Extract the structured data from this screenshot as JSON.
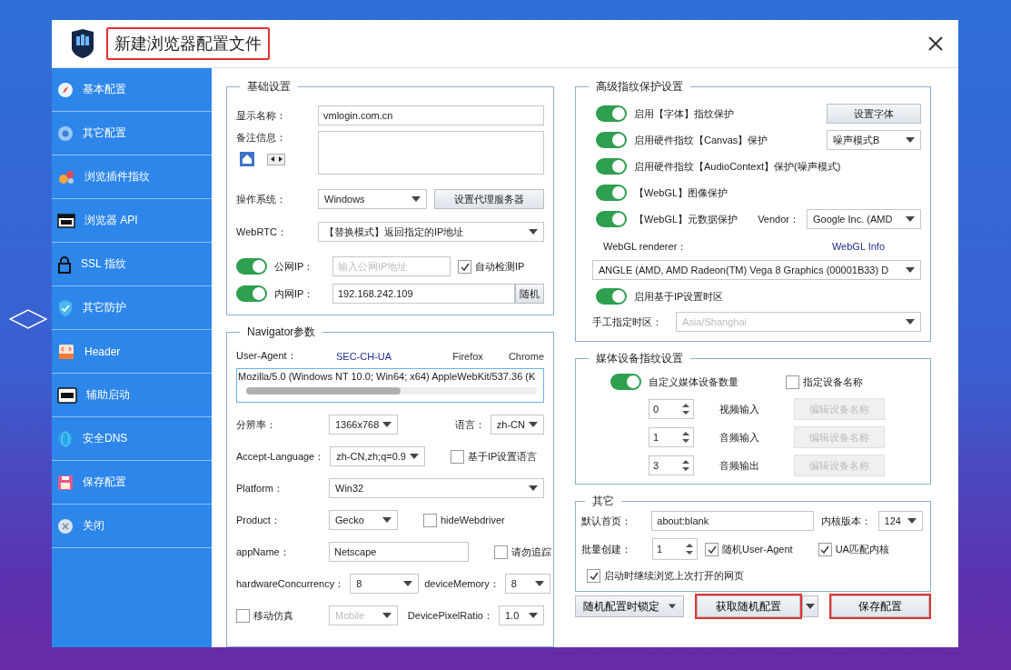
{
  "window": {
    "title": "新建浏览器配置文件",
    "highlighted": true
  },
  "sidebar": {
    "items": [
      {
        "label": "基本配置",
        "kind": "compass"
      },
      {
        "label": "其它配置",
        "kind": "chrome"
      },
      {
        "label": "浏览插件指纹",
        "kind": "plugin"
      },
      {
        "label": "浏览器 API",
        "kind": "api"
      },
      {
        "label": "SSL 指纹",
        "kind": "lock"
      },
      {
        "label": "其它防护",
        "kind": "shield"
      },
      {
        "label": "Header",
        "kind": "html"
      },
      {
        "label": "辅助启动",
        "kind": "cmd"
      },
      {
        "label": "安全DNS",
        "kind": "dns"
      },
      {
        "label": "保存配置",
        "kind": "save"
      },
      {
        "label": "关闭",
        "kind": "close"
      }
    ]
  },
  "basic": {
    "title": "基础设置",
    "display_name": {
      "label": "显示名称：",
      "value": "vmlogin.com.cn"
    },
    "notes": {
      "label": "备注信息："
    },
    "os": {
      "label": "操作系统：",
      "value": "Windows",
      "button": "设置代理服务器"
    },
    "webrtc": {
      "label": "WebRTC：",
      "value": "【替换模式】返回指定的IP地址"
    },
    "public_ip": {
      "on": true,
      "label": "公网IP：",
      "placeholder": "输入公网IP地址",
      "checkbox": {
        "label": "自动检测IP",
        "checked": true
      }
    },
    "private_ip": {
      "on": true,
      "label": "内网IP：",
      "value": "192.168.242.109",
      "button": "随机"
    }
  },
  "navigator": {
    "title": "Navigator参数",
    "ua_label": "User-Agent：",
    "ua_links": [
      "SEC-CH-UA",
      "Firefox",
      "Chrome"
    ],
    "ua_value": "Mozilla/5.0 (Windows NT 10.0; Win64; x64) AppleWebKit/537.36 (K",
    "rows": [
      [
        {
          "kind": "label",
          "text": "分辨率："
        },
        {
          "kind": "select",
          "value": "1366x768"
        },
        {
          "kind": "label",
          "text": "语言："
        },
        {
          "kind": "select",
          "value": "zh-CN"
        }
      ],
      [
        {
          "kind": "label",
          "text": "Accept-Language："
        },
        {
          "kind": "select",
          "value": "zh-CN,zh;q=0.9"
        },
        {
          "kind": "checkbox",
          "text": "基于IP设置语言",
          "checked": false
        }
      ],
      [
        {
          "kind": "label",
          "text": "Platform："
        },
        {
          "kind": "select",
          "value": "Win32"
        }
      ],
      [
        {
          "kind": "label",
          "text": "Product："
        },
        {
          "kind": "select",
          "value": "Gecko"
        },
        {
          "kind": "checkbox",
          "text": "hideWebdriver",
          "checked": false
        }
      ],
      [
        {
          "kind": "label",
          "text": "appName："
        },
        {
          "kind": "input",
          "value": "Netscape"
        },
        {
          "kind": "checkbox",
          "text": "请勿追踪",
          "checked": false
        }
      ],
      [
        {
          "kind": "label",
          "text": "hardwareConcurrency："
        },
        {
          "kind": "select",
          "value": "8"
        },
        {
          "kind": "label",
          "text": "deviceMemory："
        },
        {
          "kind": "select",
          "value": "8"
        }
      ],
      [
        {
          "kind": "checkbox",
          "text": "移动仿真",
          "checked": false
        },
        {
          "kind": "select",
          "value": "Mobile",
          "disabled": true
        },
        {
          "kind": "label",
          "text": "DevicePixelRatio："
        },
        {
          "kind": "select",
          "value": "1.0"
        }
      ]
    ]
  },
  "advanced": {
    "title": "高级指纹保护设置",
    "toggles": [
      {
        "on": true,
        "label": "启用【字体】指纹保护",
        "kind": "button",
        "control": "设置字体"
      },
      {
        "on": true,
        "label": "启用硬件指纹【Canvas】保护",
        "kind": "select",
        "control": "噪声模式B"
      },
      {
        "on": true,
        "label": "启用硬件指纹【AudioContext】保护(噪声模式)",
        "kind": "plain"
      },
      {
        "on": true,
        "label": "【WebGL】图像保护",
        "kind": "plain"
      },
      {
        "on": true,
        "label": "【WebGL】元数据保护",
        "kind": "vendor",
        "vendor_label": "Vendor：",
        "control": "Google Inc. (AMD"
      }
    ],
    "renderer": {
      "label": "WebGL renderer：",
      "link": "WebGL Info",
      "value": "ANGLE (AMD, AMD Radeon(TM) Vega 8 Graphics (00001B33) D"
    },
    "timezone_toggle": {
      "on": true,
      "label": "启用基于IP设置时区"
    },
    "timezone": {
      "label": "手工指定时区：",
      "value": "Asia/Shanghai",
      "disabled": true
    }
  },
  "media": {
    "title": "媒体设备指纹设置",
    "toggle": {
      "on": true,
      "label": "自定义媒体设备数量"
    },
    "name_checkbox": {
      "label": "指定设备名称",
      "checked": false
    },
    "devices": [
      {
        "value": "0",
        "label": "视频输入",
        "button": "编辑设备名称",
        "disabled": true
      },
      {
        "value": "1",
        "label": "音频输入",
        "button": "编辑设备名称",
        "disabled": true
      },
      {
        "value": "3",
        "label": "音频输出",
        "button": "编辑设备名称",
        "disabled": true
      }
    ]
  },
  "other": {
    "title": "其它",
    "homepage": {
      "label": "默认首页：",
      "value": "about:blank"
    },
    "kernel": {
      "label": "内核版本：",
      "value": "124"
    },
    "batch": {
      "label": "批量创建：",
      "value": "1"
    },
    "checkboxes": [
      {
        "label": "随机User-Agent",
        "checked": true
      },
      {
        "label": "UA匹配内核",
        "checked": true
      },
      {
        "label": "启动时继续浏览上次打开的网页",
        "checked": true
      }
    ]
  },
  "footer_buttons": [
    {
      "label": "随机配置时锁定",
      "kind": "dropdown",
      "highlighted": false
    },
    {
      "label": "获取随机配置",
      "kind": "split",
      "highlighted": true
    },
    {
      "label": "保存配置",
      "kind": "plain",
      "highlighted": true
    }
  ]
}
